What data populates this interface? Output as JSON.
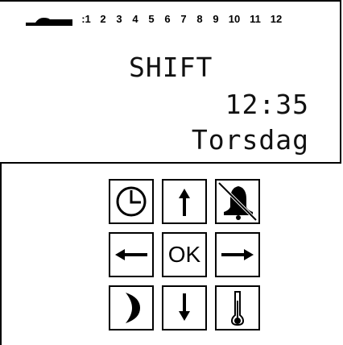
{
  "display": {
    "tick_prefix": ":1",
    "ticks": [
      "2",
      "3",
      "4",
      "5",
      "6",
      "7",
      "8",
      "9",
      "10",
      "11",
      "12"
    ],
    "mode": "SHIFT",
    "time": "12:35",
    "day": "Torsdag"
  },
  "keypad": {
    "ok_label": "OK",
    "keys": [
      "clock-icon",
      "arrow-up-icon",
      "alarm-off-icon",
      "arrow-left-icon",
      "ok",
      "arrow-right-icon",
      "moon-icon",
      "arrow-down-icon",
      "thermometer-icon"
    ]
  }
}
